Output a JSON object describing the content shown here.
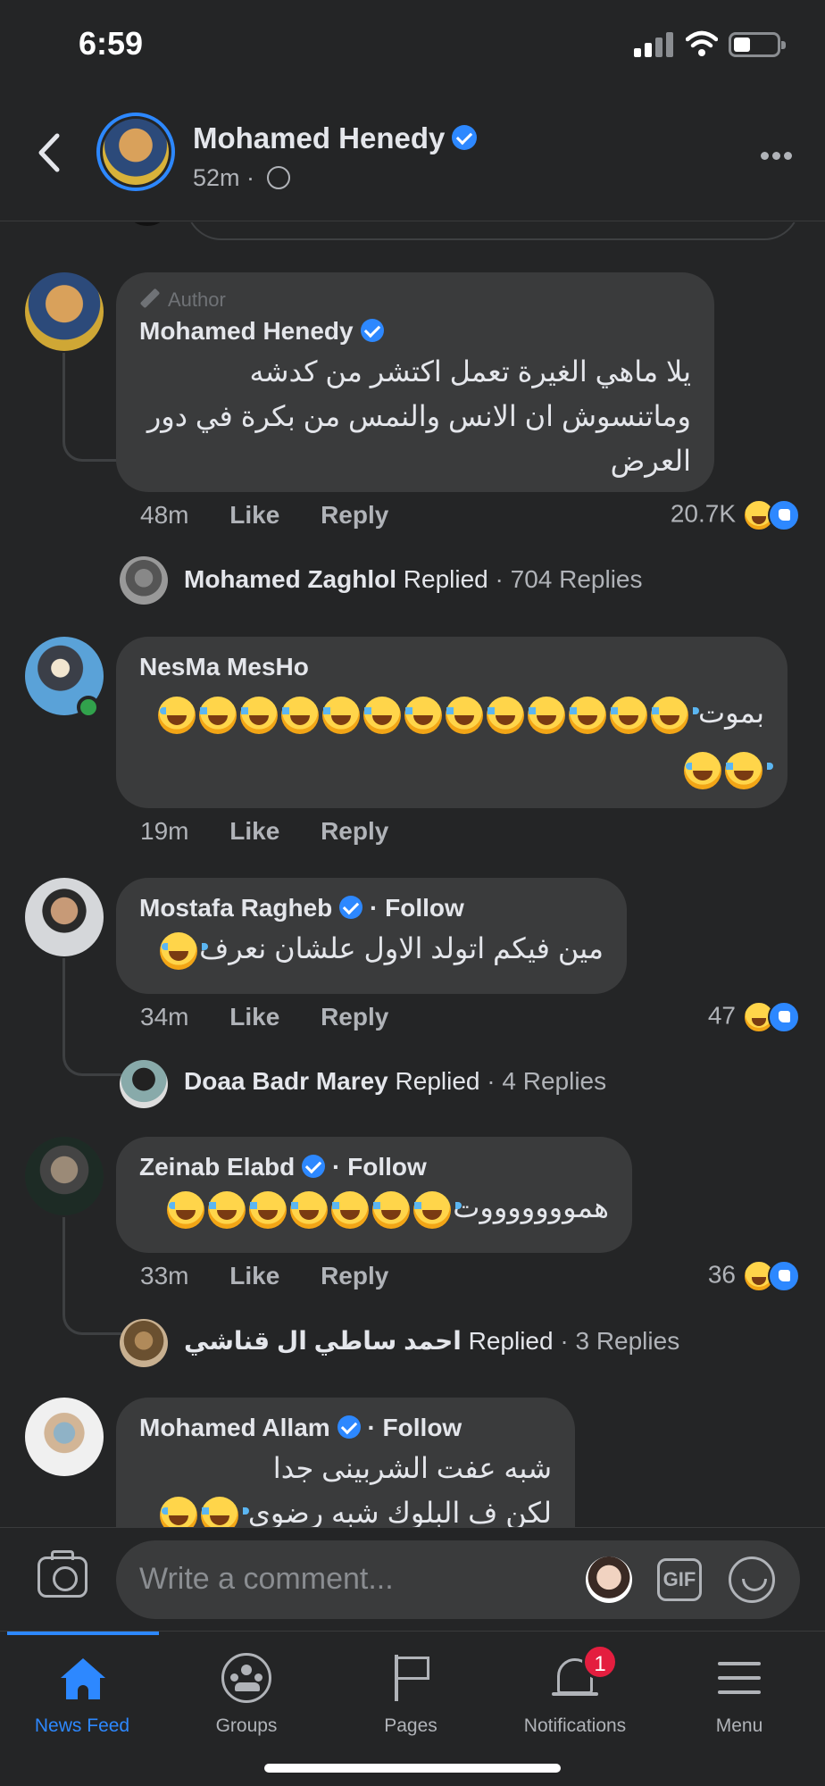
{
  "status_bar": {
    "time": "6:59"
  },
  "header": {
    "name": "Mohamed Henedy",
    "time": "52m",
    "separator": "·"
  },
  "comments": [
    {
      "badge": "Author",
      "name": "Mohamed Henedy",
      "verified": true,
      "text": "يلا ماهي الغيرة تعمل اكتشر من كدشه وماتنسوش ان الانس والنمس من بكرة في دور العرض",
      "time": "48m",
      "like": "Like",
      "reply": "Reply",
      "reactions": "20.7K",
      "replied_name": "Mohamed Zaghlol",
      "replied_word": "Replied",
      "replied_count": "· 704 Replies"
    },
    {
      "name": "NesMa MesHo",
      "text": "بموت",
      "emoji_count": 15,
      "time": "19m",
      "like": "Like",
      "reply": "Reply"
    },
    {
      "name": "Mostafa Ragheb",
      "verified": true,
      "follow": "· Follow",
      "text": "مين فيكم اتولد الاول علشان نعرف",
      "emoji_count": 1,
      "time": "34m",
      "like": "Like",
      "reply": "Reply",
      "reactions": "47",
      "replied_name": "Doaa Badr Marey",
      "replied_word": "Replied",
      "replied_count": "· 4 Replies"
    },
    {
      "name": "Zeinab Elabd",
      "verified": true,
      "follow": "· Follow",
      "text": "هموووووووت",
      "emoji_count": 7,
      "time": "33m",
      "like": "Like",
      "reply": "Reply",
      "reactions": "36",
      "replied_name": "احمد ساطي ال قناشي",
      "replied_word": "Replied",
      "replied_count": "· 3 Replies"
    },
    {
      "name": "Mohamed Allam",
      "verified": true,
      "follow": "· Follow",
      "text": "شبه عفت الشربينى جدا",
      "text2": "لكن ف البلوك شبه رضوى"
    }
  ],
  "composer": {
    "placeholder": "Write a comment...",
    "gif": "GIF"
  },
  "tabs": [
    {
      "label": "News Feed",
      "icon": "home-icon",
      "active": true
    },
    {
      "label": "Groups",
      "icon": "groups-icon"
    },
    {
      "label": "Pages",
      "icon": "flag-icon"
    },
    {
      "label": "Notifications",
      "icon": "bell-icon",
      "badge": "1"
    },
    {
      "label": "Menu",
      "icon": "menu-icon"
    }
  ],
  "colors": {
    "accent": "#2d88ff",
    "background": "#242526",
    "bubble": "#3a3b3c",
    "badge": "#e41e3f",
    "online": "#31a24c"
  }
}
